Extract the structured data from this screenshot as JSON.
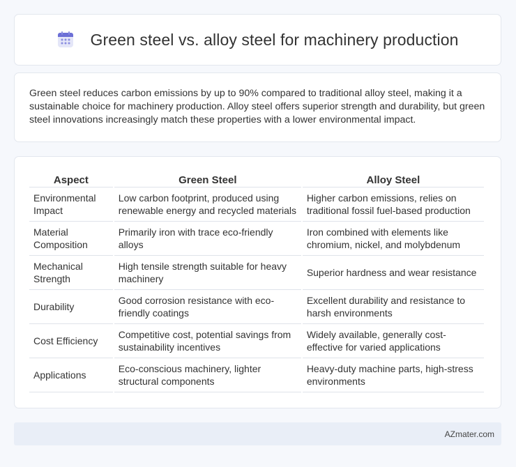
{
  "header": {
    "title": "Green steel vs. alloy steel for machinery production",
    "icon": "calendar-icon",
    "icon_color": "#6c6fd6"
  },
  "summary": {
    "text": "Green steel reduces carbon emissions by up to 90% compared to traditional alloy steel, making it a sustainable choice for machinery production. Alloy steel offers superior strength and durability, but green steel innovations increasingly match these properties with a lower environmental impact."
  },
  "table": {
    "headers": [
      "Aspect",
      "Green Steel",
      "Alloy Steel"
    ],
    "rows": [
      [
        "Environmental Impact",
        "Low carbon footprint, produced using renewable energy and recycled materials",
        "Higher carbon emissions, relies on traditional fossil fuel-based production"
      ],
      [
        "Material Composition",
        "Primarily iron with trace eco-friendly alloys",
        "Iron combined with elements like chromium, nickel, and molybdenum"
      ],
      [
        "Mechanical Strength",
        "High tensile strength suitable for heavy machinery",
        "Superior hardness and wear resistance"
      ],
      [
        "Durability",
        "Good corrosion resistance with eco-friendly coatings",
        "Excellent durability and resistance to harsh environments"
      ],
      [
        "Cost Efficiency",
        "Competitive cost, potential savings from sustainability incentives",
        "Widely available, generally cost-effective for varied applications"
      ],
      [
        "Applications",
        "Eco-conscious machinery, lighter structural components",
        "Heavy-duty machine parts, high-stress environments"
      ]
    ]
  },
  "footer": {
    "text": "AZmater.com"
  }
}
